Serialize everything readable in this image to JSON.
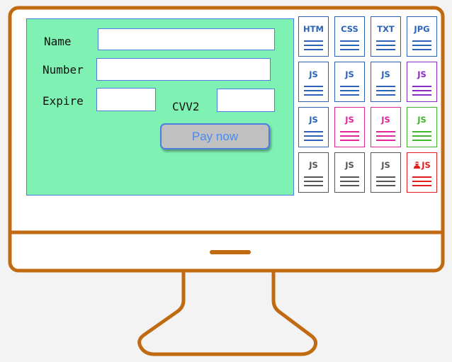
{
  "payment_form": {
    "name_label": "Name",
    "number_label": "Number",
    "expire_label": "Expire",
    "cvv_label": "CVV2",
    "name_value": "",
    "number_value": "",
    "expire_value": "",
    "cvv_value": "",
    "pay_button": "Pay now"
  },
  "colors": {
    "monitor_frame": "#c06a12",
    "form_background": "#7ff2b3",
    "field_border": "#4a7fe0",
    "button_text": "#4a8af0"
  },
  "resources": [
    {
      "label": "HTM",
      "color": "#2a63b8",
      "icon": ""
    },
    {
      "label": "CSS",
      "color": "#2a63b8",
      "icon": ""
    },
    {
      "label": "TXT",
      "color": "#2a63b8",
      "icon": ""
    },
    {
      "label": "JPG",
      "color": "#2a63b8",
      "icon": ""
    },
    {
      "label": "JS",
      "color": "#2a63b8",
      "icon": ""
    },
    {
      "label": "JS",
      "color": "#2a63b8",
      "icon": ""
    },
    {
      "label": "JS",
      "color": "#2a63b8",
      "icon": ""
    },
    {
      "label": "JS",
      "color": "#8a2bc8",
      "icon": ""
    },
    {
      "label": "JS",
      "color": "#2a63b8",
      "icon": ""
    },
    {
      "label": "JS",
      "color": "#e0259a",
      "icon": ""
    },
    {
      "label": "JS",
      "color": "#e0259a",
      "icon": ""
    },
    {
      "label": "JS",
      "color": "#3eb82a",
      "icon": ""
    },
    {
      "label": "JS",
      "color": "#555555",
      "icon": ""
    },
    {
      "label": "JS",
      "color": "#555555",
      "icon": ""
    },
    {
      "label": "JS",
      "color": "#555555",
      "icon": ""
    },
    {
      "label": "JS",
      "color": "#e01c1c",
      "icon": "hacker-icon"
    }
  ]
}
